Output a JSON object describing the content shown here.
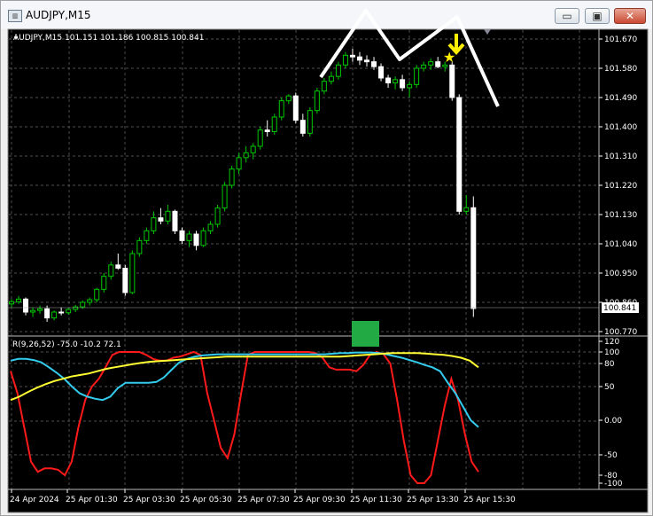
{
  "window": {
    "title": "AUDJPY,M15",
    "app_icon": "chart-window-icon",
    "minimize_glyph": "▭",
    "maximize_glyph": "▣",
    "close_glyph": "✕"
  },
  "chart": {
    "header": "AUDJPY,M15  101.151 101.186 100.815 100.841",
    "current_price": "100.841",
    "colors": {
      "bull": "#00c800",
      "bear": "#ffffff",
      "grid": "#6a6a6a",
      "text": "#ffffff",
      "price_tag_bg": "#ffffff"
    },
    "price_labels": [
      "101.670",
      "101.580",
      "101.490",
      "101.400",
      "101.310",
      "101.220",
      "101.130",
      "101.040",
      "100.950",
      "100.860",
      "100.770"
    ],
    "time_labels": [
      "24 Apr 2024",
      "25 Apr 01:30",
      "25 Apr 03:30",
      "25 Apr 05:30",
      "25 Apr 07:30",
      "25 Apr 09:30",
      "25 Apr 11:30",
      "25 Apr 13:30",
      "25 Apr 15:30"
    ]
  },
  "indicator": {
    "label": "R(9,26,52) -75.0 -10.2 72.1",
    "levels": [
      "120",
      "100",
      "80",
      "50",
      "0.00",
      "-50",
      "-80",
      "-100"
    ],
    "series": [
      {
        "name": "fast",
        "color": "#ff1a1a"
      },
      {
        "name": "middle",
        "color": "#33ccee"
      },
      {
        "name": "slow",
        "color": "#ffff33"
      }
    ]
  },
  "annotations": {
    "pattern_color": "#ffffff",
    "arrow_color": "#ffee00",
    "star_color": "#ffee00",
    "marker_color": "#22aa44"
  }
}
